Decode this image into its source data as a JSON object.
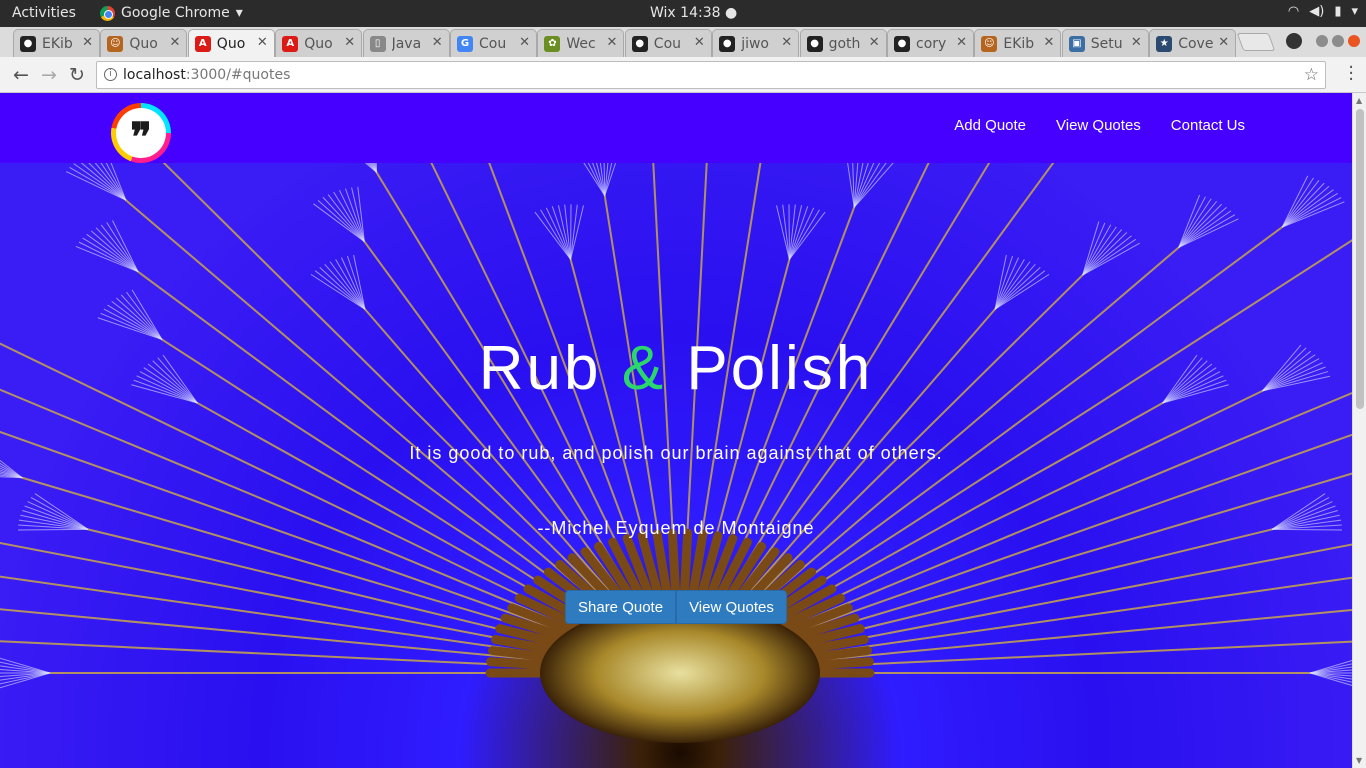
{
  "os": {
    "activities": "Activities",
    "app_name": "Google Chrome",
    "clock": "Wix 14:38 ●"
  },
  "tabs": [
    {
      "label": "EKib",
      "icon": "github-icon",
      "active": false
    },
    {
      "label": "Quo",
      "icon": "avatar-icon",
      "active": false
    },
    {
      "label": "Quo",
      "icon": "angular-icon",
      "active": true
    },
    {
      "label": "Quo",
      "icon": "angular-icon",
      "active": false
    },
    {
      "label": "Java",
      "icon": "document-icon",
      "active": false
    },
    {
      "label": "Cou",
      "icon": "google-icon",
      "active": false
    },
    {
      "label": "Wec",
      "icon": "plant-icon",
      "active": false
    },
    {
      "label": "Cou",
      "icon": "github-icon",
      "active": false
    },
    {
      "label": "jiwo",
      "icon": "github-icon",
      "active": false
    },
    {
      "label": "goth",
      "icon": "github-icon",
      "active": false
    },
    {
      "label": "cory",
      "icon": "github-icon",
      "active": false
    },
    {
      "label": "EKib",
      "icon": "avatar-icon",
      "active": false
    },
    {
      "label": "Setu",
      "icon": "image-icon",
      "active": false
    },
    {
      "label": "Cove",
      "icon": "star-icon",
      "active": false
    }
  ],
  "address": {
    "host": "localhost",
    "path": ":3000/#quotes"
  },
  "nav": {
    "links": [
      "Add Quote",
      "View Quotes",
      "Contact Us"
    ]
  },
  "hero": {
    "title_part1": "Rub ",
    "title_amp": "&",
    "title_part2": " Polish",
    "quote": "It is good to rub, and polish our brain against that of others.",
    "author": "--Michel Eyquem de Montaigne",
    "share_button": "Share Quote",
    "view_button": "View Quotes"
  },
  "colors": {
    "navbar": "#4600ff",
    "accent_amp": "#2bd66a",
    "button": "#2f7bbf"
  }
}
